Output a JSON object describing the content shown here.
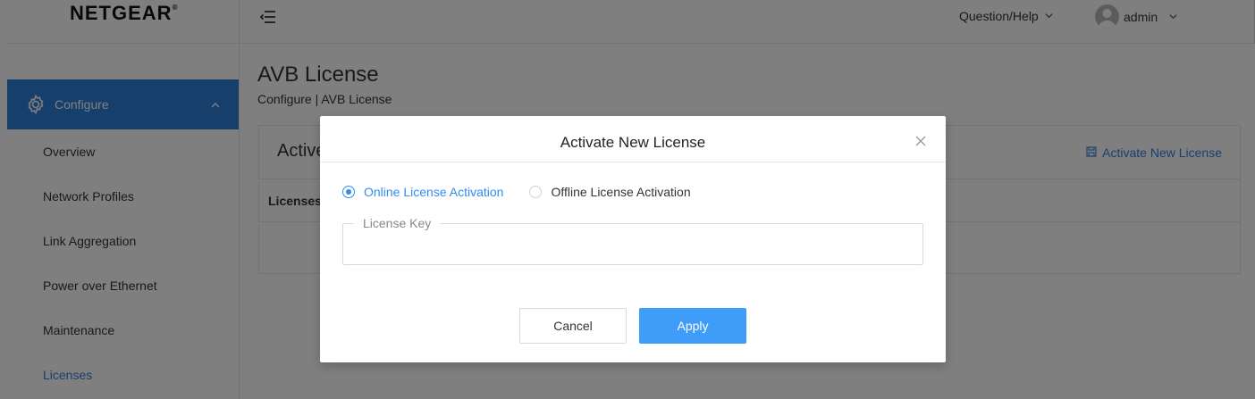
{
  "brand": {
    "logo": "NETGEAR",
    "logo_mark": "®"
  },
  "header": {
    "help_label": "Question/Help",
    "user_label": "admin"
  },
  "sidebar": {
    "group_label": "Configure",
    "items": [
      {
        "label": "Overview"
      },
      {
        "label": "Network Profiles"
      },
      {
        "label": "Link Aggregation"
      },
      {
        "label": "Power over Ethernet"
      },
      {
        "label": "Maintenance"
      },
      {
        "label": "Licenses"
      }
    ]
  },
  "page": {
    "title": "AVB License",
    "breadcrumb": "Configure | AVB License",
    "card_title": "Active",
    "card_action": "Activate New License",
    "card_column": "Licenses"
  },
  "modal": {
    "title": "Activate New License",
    "radio_online": "Online License Activation",
    "radio_offline": "Offline License Activation",
    "selected": "online",
    "field_label": "License Key",
    "field_value": "",
    "cancel_label": "Cancel",
    "apply_label": "Apply"
  },
  "colors": {
    "accent": "#2f7fd8",
    "apply_button": "#3f9cf8",
    "overlay": "rgba(0,0,0,0.5)"
  }
}
